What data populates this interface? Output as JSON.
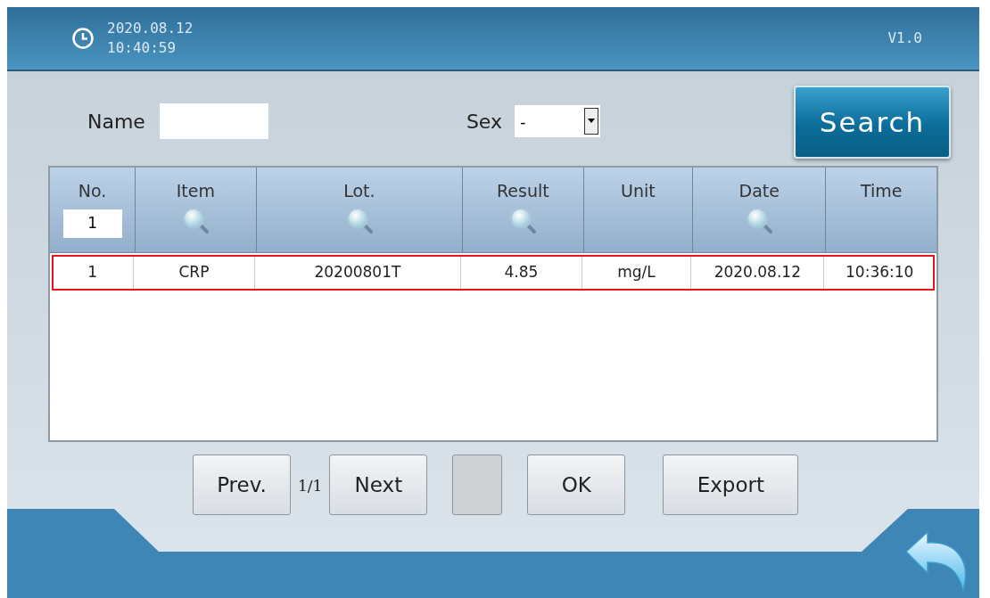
{
  "header": {
    "date": "2020.08.12",
    "time": "10:40:59",
    "version": "V1.0"
  },
  "filters": {
    "name_label": "Name",
    "sex_label": "Sex",
    "sex_value": "-",
    "search_button": "Search"
  },
  "table": {
    "columns": [
      {
        "label": "No.",
        "kind": "input",
        "value": "1"
      },
      {
        "label": "Item",
        "kind": "search"
      },
      {
        "label": "Lot.",
        "kind": "search"
      },
      {
        "label": "Result",
        "kind": "search"
      },
      {
        "label": "Unit",
        "kind": "plain"
      },
      {
        "label": "Date",
        "kind": "search"
      },
      {
        "label": "Time",
        "kind": "plain"
      }
    ],
    "rows": [
      {
        "cells": [
          "1",
          "CRP",
          "20200801T",
          "4.85",
          "mg/L",
          "2020.08.12",
          "10:36:10"
        ],
        "selected": true
      }
    ]
  },
  "pagination": {
    "prev": "Prev.",
    "page": "1/1",
    "next": "Next"
  },
  "buttons": [
    {
      "kind": "blank"
    },
    {
      "kind": "text",
      "label": "OK"
    },
    {
      "kind": "text",
      "label": "Export"
    }
  ]
}
